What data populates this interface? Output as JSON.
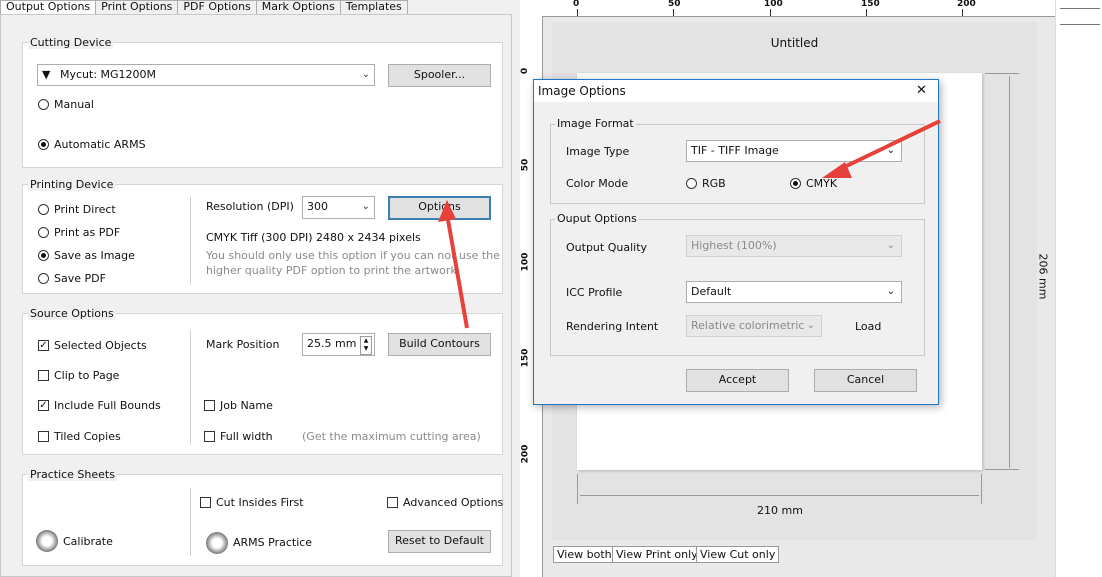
{
  "tabs": [
    "Output Options",
    "Print Options",
    "PDF Options",
    "Mark Options",
    "Templates"
  ],
  "cutting_device": {
    "title": "Cutting Device",
    "device": "Mycut: MG1200M",
    "spooler": "Spooler...",
    "manual": "Manual",
    "automatic": "Automatic ARMS"
  },
  "printing_device": {
    "title": "Printing Device",
    "options": [
      "Print Direct",
      "Print as PDF",
      "Save as Image",
      "Save PDF"
    ],
    "resolution_label": "Resolution (DPI)",
    "resolution_value": "300",
    "options_button": "Options",
    "info": "CMYK Tiff  (300 DPI) 2480 x 2434 pixels",
    "note_line1": "You should only use this option if you can not use the",
    "note_line2": "higher quality PDF option to print the artwork."
  },
  "source_options": {
    "title": "Source Options",
    "selected_objects": "Selected Objects",
    "clip_to_page": "Clip to Page",
    "include_full_bounds": "Include Full Bounds",
    "tiled_copies": "Tiled Copies",
    "mark_position_label": "Mark Position",
    "mark_position_value": "25.5 mm",
    "build_contours": "Build Contours",
    "job_name": "Job Name",
    "full_width": "Full width",
    "full_width_hint": "(Get the maximum cutting area)"
  },
  "practice_sheets": {
    "title": "Practice Sheets",
    "cut_insides_first": "Cut Insides First",
    "advanced_options": "Advanced Options",
    "calibrate": "Calibrate",
    "arms_practice": "ARMS Practice",
    "reset_default": "Reset to Default"
  },
  "preview": {
    "title": "Untitled",
    "width_label": "210 mm",
    "height_label": "206 mm",
    "top_ruler": [
      "0",
      "50",
      "100",
      "150",
      "200"
    ],
    "left_ruler": [
      "0",
      "50",
      "100",
      "150",
      "200"
    ],
    "view_tabs": [
      "View both",
      "View Print only",
      "View Cut only"
    ]
  },
  "dialog": {
    "title": "Image Options",
    "close": "✕",
    "image_format_title": "Image Format",
    "image_type_label": "Image Type",
    "image_type_value": "TIF - TIFF Image",
    "color_mode_label": "Color Mode",
    "rgb": "RGB",
    "cmyk": "CMYK",
    "output_options_title": "Ouput Options",
    "output_quality_label": "Output Quality",
    "output_quality_value": "Highest (100%)",
    "icc_profile_label": "ICC Profile",
    "icc_profile_value": "Default",
    "rendering_intent_label": "Rendering Intent",
    "rendering_intent_value": "Relative colorimetric",
    "load": "Load",
    "accept": "Accept",
    "cancel": "Cancel"
  },
  "colors": {
    "accent": "#1e78c8",
    "arrow": "#e8403b"
  }
}
